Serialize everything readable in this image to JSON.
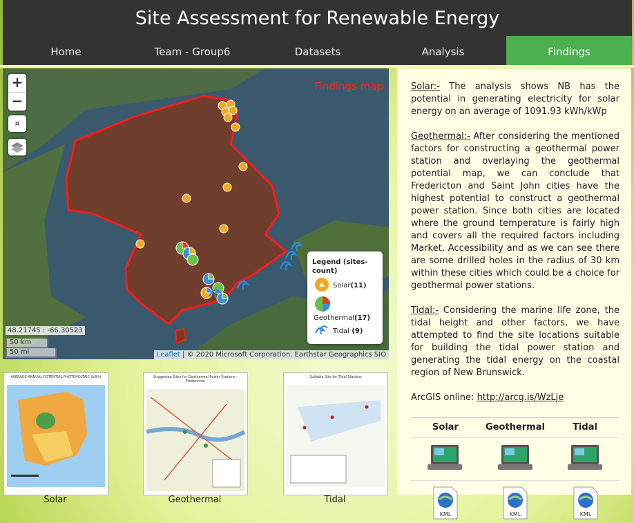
{
  "header": {
    "title": "Site Assessment for Renewable Energy"
  },
  "nav": {
    "items": [
      {
        "label": "Home"
      },
      {
        "label": "Team - Group6"
      },
      {
        "label": "Datasets"
      },
      {
        "label": "Analysis"
      },
      {
        "label": "Findings"
      }
    ],
    "active": "Findings",
    "active_color": "#4caf50",
    "bar_color": "#333333"
  },
  "map": {
    "title": "Findings map",
    "zoom_in": "+",
    "zoom_out": "−",
    "locate_icon": "crosshair-icon",
    "layers_icon": "layers-icon",
    "coords": "48.21745 : -66.30523",
    "scale_km": "50 km",
    "scale_mi": "50 mi",
    "attribution_link": "Leaflet",
    "attribution_text": " | © 2020 Microsoft Corporation, Earthstar Geographics SIO",
    "boundary_color": "#ff1a1a",
    "legend": {
      "title": "Legend (sites-count)",
      "items": [
        {
          "label": "Solar",
          "count": "(11)",
          "icon": "solar-marker-icon"
        },
        {
          "label": "Geothermal",
          "count": "(17)",
          "icon": "geothermal-marker-icon"
        },
        {
          "label": "Tidal",
          "count": " (9)",
          "icon": "tidal-wave-icon"
        }
      ]
    }
  },
  "findings": {
    "solar_head": "Solar:-",
    "solar_text": " The analysis shows NB has the potential in generating electricity for solar energy on an average of 1091.93 kWh/kWp",
    "geo_head": "Geothermal:-",
    "geo_text": " After considering the mentioned factors for constructing a geothermal power station and overlaying the geothermal potential map, we can conclude that Fredericton and Saint John cities have the highest potential to construct a geothermal power station. Since both cities are located where the ground temperature is fairly high and covers all the required factors including Market, Accessibility and as we can see there are some drilled holes in the radius of 30 km within these cities which could be a choice for geothermal power stations.",
    "tidal_head": "Tidal:-",
    "tidal_text": " Considering the marine life zone, the tidal height and other factors, we have attempted to find the site locations suitable for building the tidal power station and generating the tidal energy on the coastal region of New Brunswick.",
    "arcgis_label": "ArcGIS online: ",
    "arcgis_link": "http://arcg.is/WzLje"
  },
  "table": {
    "headers": [
      "Solar",
      "Geothermal",
      "Tidal"
    ],
    "app_icon": "laptop-app-icon",
    "kml_label": "KML"
  },
  "thumbnails": [
    {
      "caption": "Solar",
      "title": "AVERAGE ANNUAL POTENTIAL PHOTOVOLTAIC (kWh)"
    },
    {
      "caption": "Geothermal",
      "title": "Suggested Sites for Geothermal Power Stations - Fredericton"
    },
    {
      "caption": "Tidal",
      "title": "Suitable Site for Tidal Stations"
    }
  ]
}
